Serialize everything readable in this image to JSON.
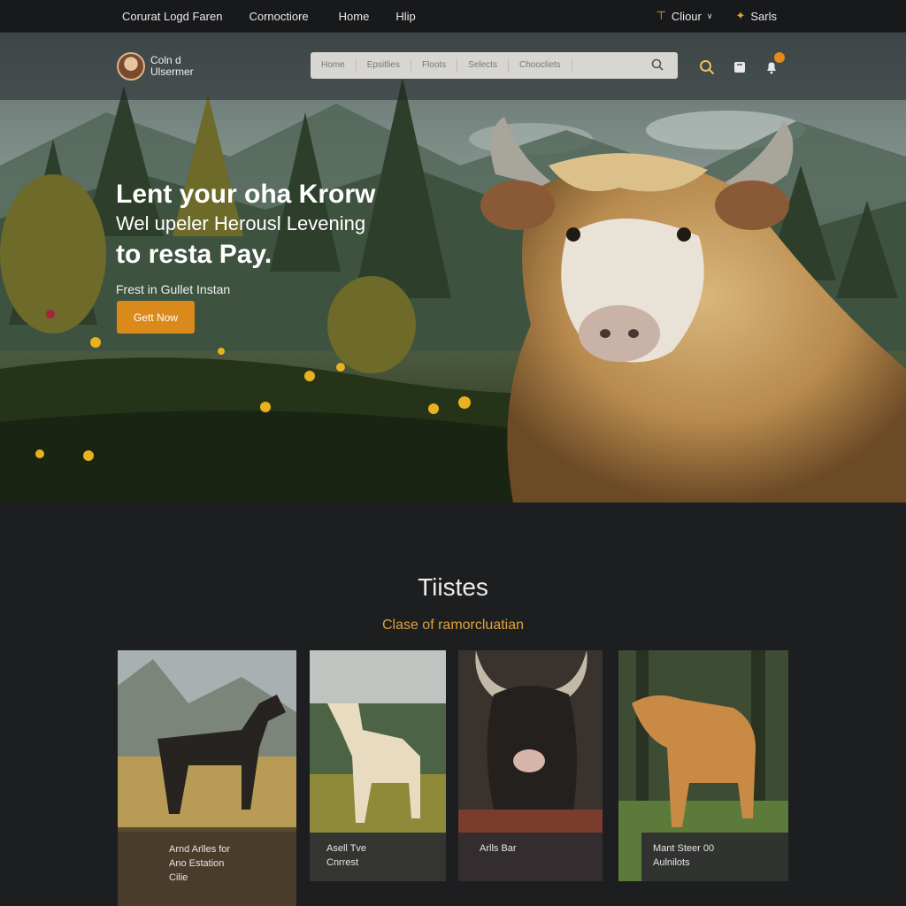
{
  "topbar": {
    "links": [
      "Corurat Logd Faren",
      "Cornoctiore",
      "Home",
      "Hlip"
    ],
    "right": [
      {
        "icon": "filter-icon",
        "label": "Cliour",
        "has_dropdown": true
      },
      {
        "icon": "bolt-icon",
        "label": "Sarls",
        "has_dropdown": false
      }
    ]
  },
  "header": {
    "logo_line1": "Coln d",
    "logo_line2": "Ulsermer",
    "search_tabs": [
      "Home",
      "Epsitlies",
      "Floots",
      "Selects",
      "Choocliets"
    ],
    "icons": [
      "search-icon",
      "bookmark-icon",
      "notification-icon"
    ]
  },
  "hero": {
    "title": "Lent your oha Krorw",
    "line2": "Wel upeler Herousl Levening",
    "line3": "to resta Pay.",
    "subtitle": "Frest in Gullet Instan",
    "cta_label": "Gett Now"
  },
  "section": {
    "title": "Tiistes",
    "subtitle": "Clase of ramorcluatian"
  },
  "cards": [
    {
      "caption": [
        "Arnd Arlles for",
        "Ano Estation",
        "Cilie"
      ],
      "animal": "black horse"
    },
    {
      "caption": [
        "Asell Tve",
        "Cnrrest"
      ],
      "animal": "cream llama"
    },
    {
      "caption": [
        "Arlls Bar"
      ],
      "animal": "dark horned bull"
    },
    {
      "caption": [
        "Mant Steer 00",
        "Aulnilots"
      ],
      "animal": "golden calf"
    }
  ],
  "colors": {
    "accent": "#d98a1b",
    "background": "#1d1e20",
    "subtitle_gold": "#e0a13a"
  }
}
